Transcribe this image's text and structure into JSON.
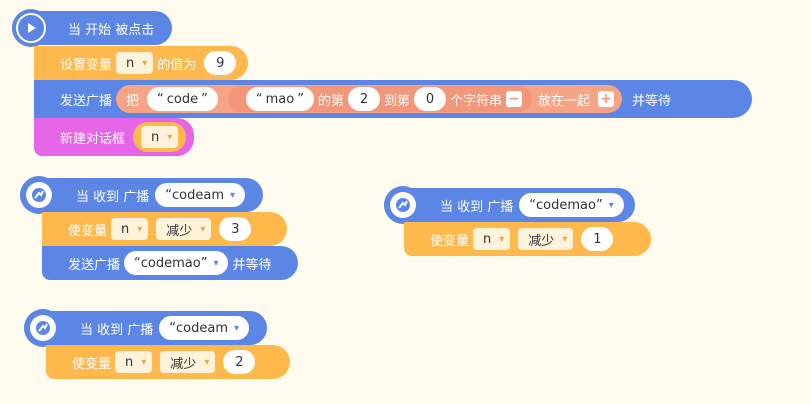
{
  "script1": {
    "hat_label": "当 开始 被点击",
    "set_var_label": "设置变量",
    "set_var_name": "n",
    "set_var_of": "的值为",
    "set_var_value": "9",
    "broadcast_label": "发送广播",
    "join_label": "把",
    "join_str1": "code",
    "substr_str": "mao",
    "substr_of": "的第",
    "substr_from": "2",
    "substr_to_label": "到第",
    "substr_to": "0",
    "substr_suffix": "个字符串",
    "minus": "−",
    "join_suffix": "放在一起",
    "plus": "+",
    "broadcast_wait": "并等待",
    "dialog_label": "新建对话框",
    "dialog_var": "n"
  },
  "script2": {
    "hat_label": "当 收到 广播",
    "hat_msg": "codeam",
    "change_label": "使变量",
    "change_var": "n",
    "change_op": "减少",
    "change_value": "3",
    "broadcast_label": "发送广播",
    "broadcast_msg": "codemao",
    "broadcast_wait": "并等待"
  },
  "script3": {
    "hat_label": "当 收到 广播",
    "hat_msg": "codeam",
    "change_label": "使变量",
    "change_var": "n",
    "change_op": "减少",
    "change_value": "2"
  },
  "script4": {
    "hat_label": "当 收到 广播",
    "hat_msg": "codemao",
    "change_label": "使变量",
    "change_var": "n",
    "change_op": "减少",
    "change_value": "1"
  },
  "colors": {
    "background": "#fffbef",
    "event_blue": "#5b86e5",
    "variable_orange": "#ffb84c",
    "dialog_pink": "#e566e7",
    "operator_salmon": "#f7a386"
  }
}
